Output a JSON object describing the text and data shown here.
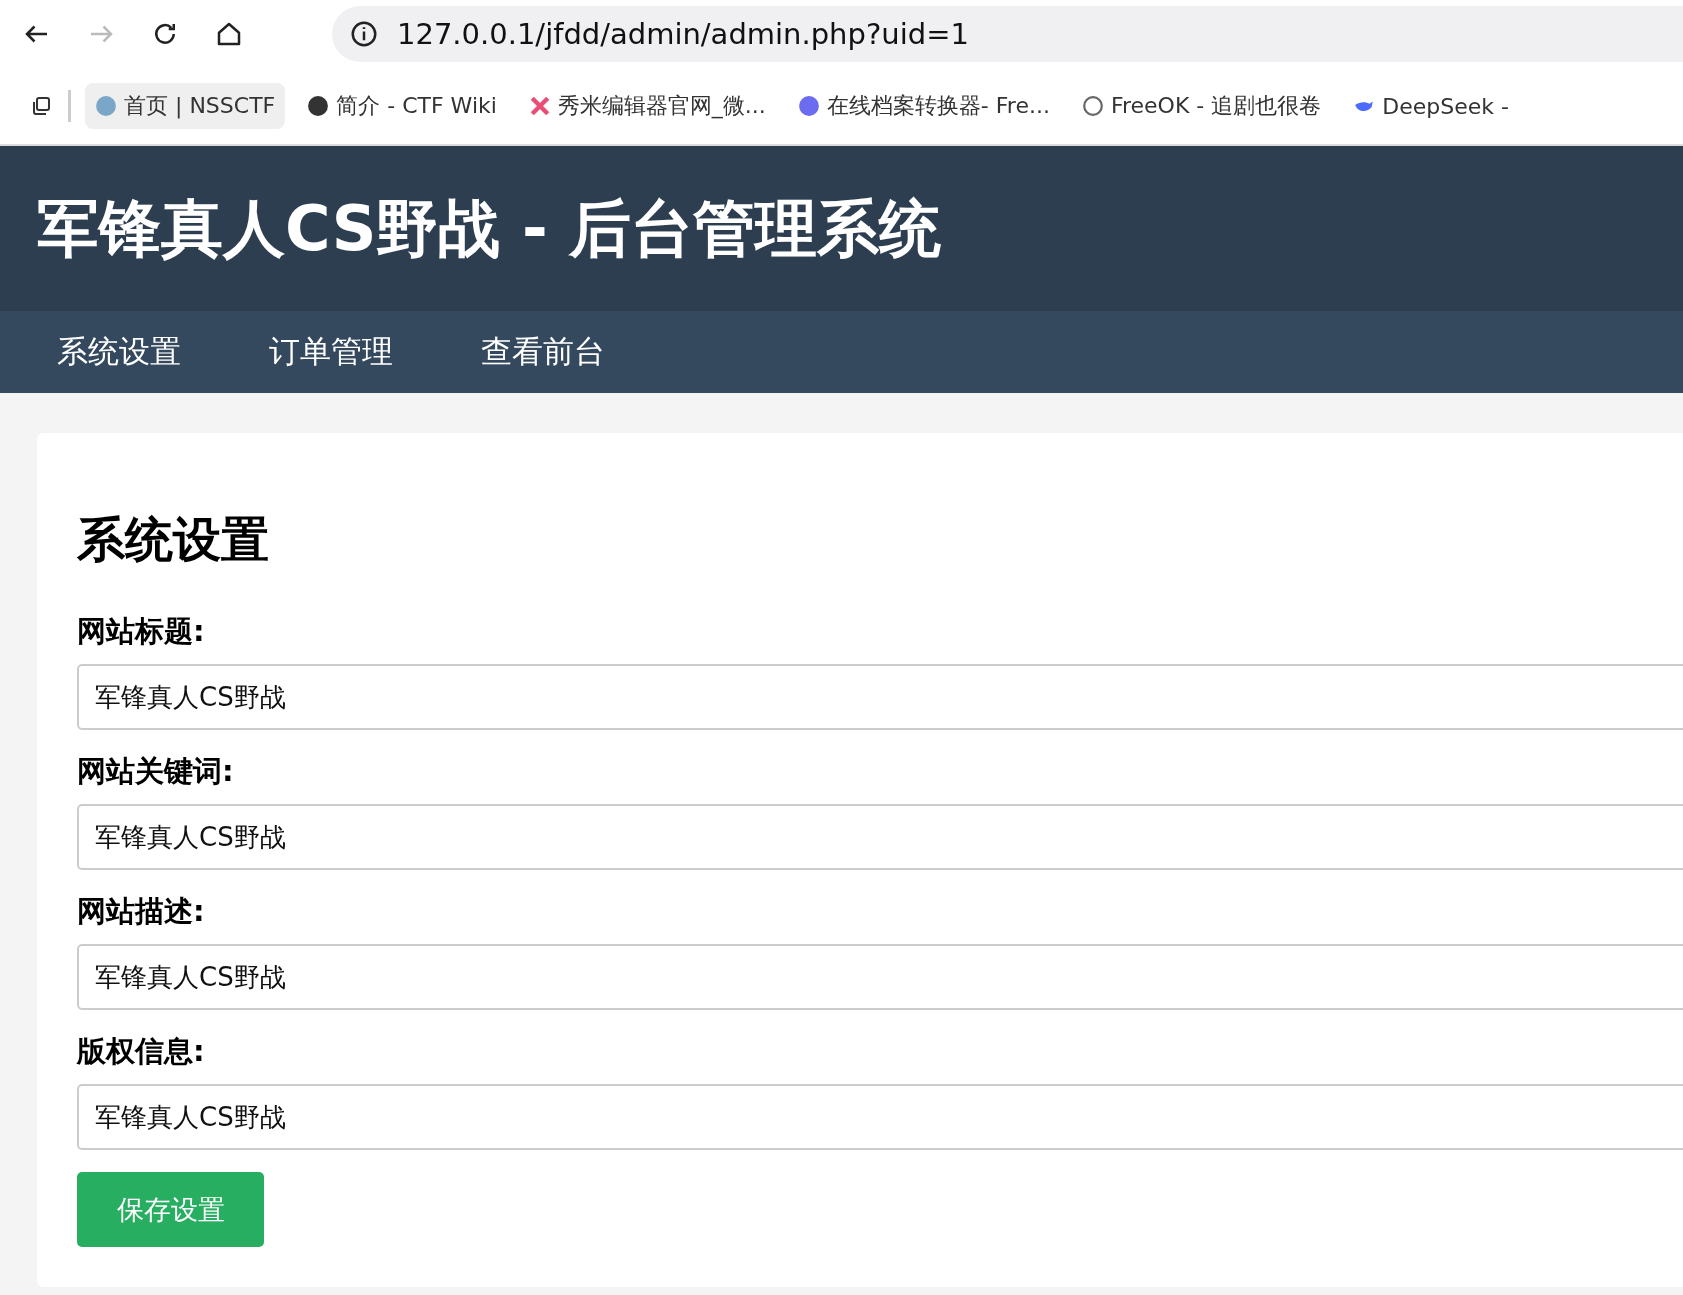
{
  "browser": {
    "address": "127.0.0.1/jfdd/admin/admin.php?uid=1",
    "bookmarks": [
      {
        "label": "首页 | NSSCTF",
        "selected": true
      },
      {
        "label": "简介 - CTF Wiki",
        "selected": false
      },
      {
        "label": "秀米编辑器官网_微...",
        "selected": false
      },
      {
        "label": "在线档案转换器- Fre...",
        "selected": false
      },
      {
        "label": "FreeOK - 追剧也很卷",
        "selected": false
      },
      {
        "label": "DeepSeek -",
        "selected": false
      }
    ]
  },
  "header": {
    "title": "军锋真人CS野战 - 后台管理系统"
  },
  "nav": [
    "系统设置",
    "订单管理",
    "查看前台"
  ],
  "settings": {
    "heading": "系统设置",
    "fields": [
      {
        "label": "网站标题:",
        "value": "军锋真人CS野战"
      },
      {
        "label": "网站关键词:",
        "value": "军锋真人CS野战"
      },
      {
        "label": "网站描述:",
        "value": "军锋真人CS野战"
      },
      {
        "label": "版权信息:",
        "value": "军锋真人CS野战"
      }
    ],
    "button": "保存设置"
  }
}
